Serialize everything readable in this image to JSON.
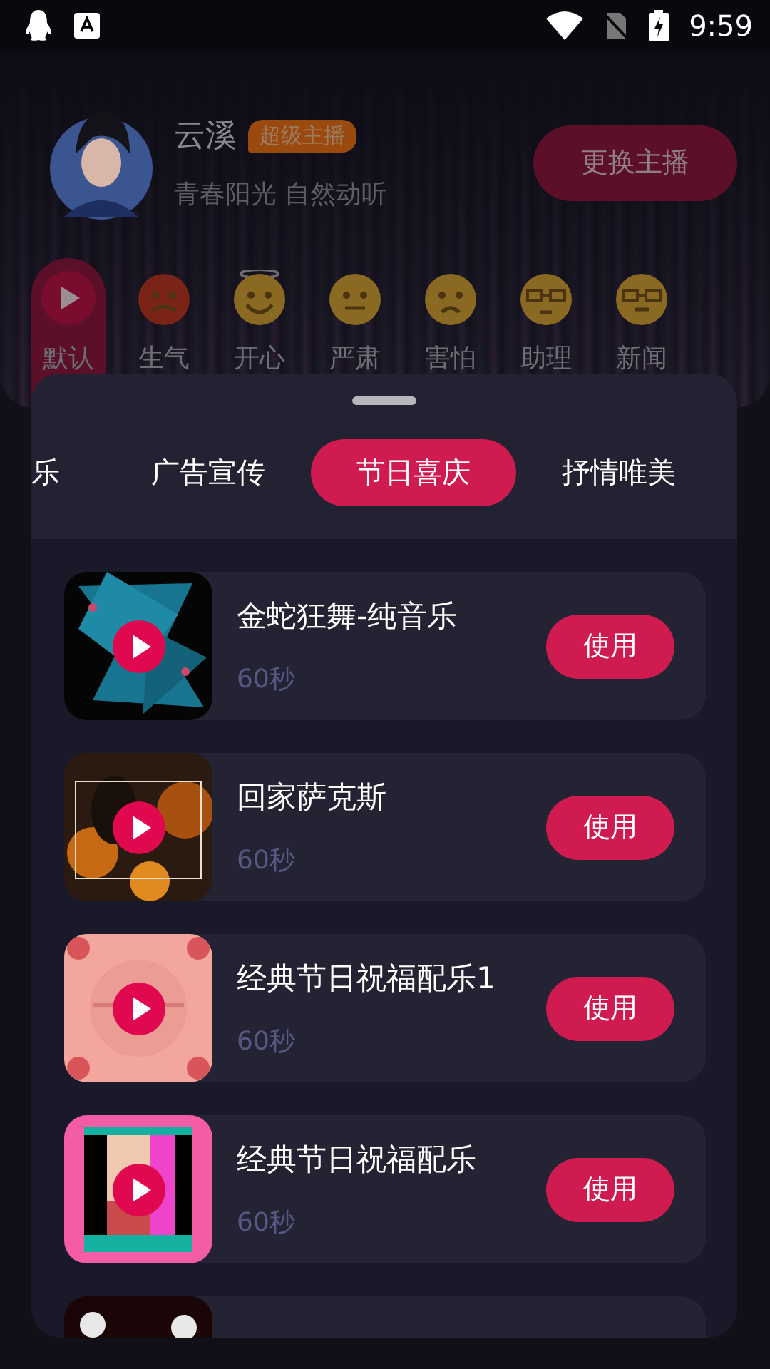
{
  "status_bar": {
    "time": "9:59"
  },
  "host": {
    "name": "云溪",
    "badge": "超级主播",
    "tagline": "青春阳光 自然动听",
    "change_button": "更换主播"
  },
  "emotions": [
    {
      "label": "默认",
      "selected": true
    },
    {
      "label": "生气",
      "selected": false
    },
    {
      "label": "开心",
      "selected": false
    },
    {
      "label": "严肃",
      "selected": false
    },
    {
      "label": "害怕",
      "selected": false
    },
    {
      "label": "助理",
      "selected": false
    },
    {
      "label": "新闻",
      "selected": false
    }
  ],
  "tabs": [
    {
      "label": "乐",
      "selected": false
    },
    {
      "label": "广告宣传",
      "selected": false
    },
    {
      "label": "节日喜庆",
      "selected": true
    },
    {
      "label": "抒情唯美",
      "selected": false
    }
  ],
  "tracks": [
    {
      "title": "金蛇狂舞-纯音乐",
      "duration": "60秒",
      "button": "使用"
    },
    {
      "title": "回家萨克斯",
      "duration": "60秒",
      "button": "使用"
    },
    {
      "title": "经典节日祝福配乐1",
      "duration": "60秒",
      "button": "使用"
    },
    {
      "title": "经典节日祝福配乐",
      "duration": "60秒",
      "button": "使用"
    },
    {
      "kind": "picture"
    }
  ]
}
